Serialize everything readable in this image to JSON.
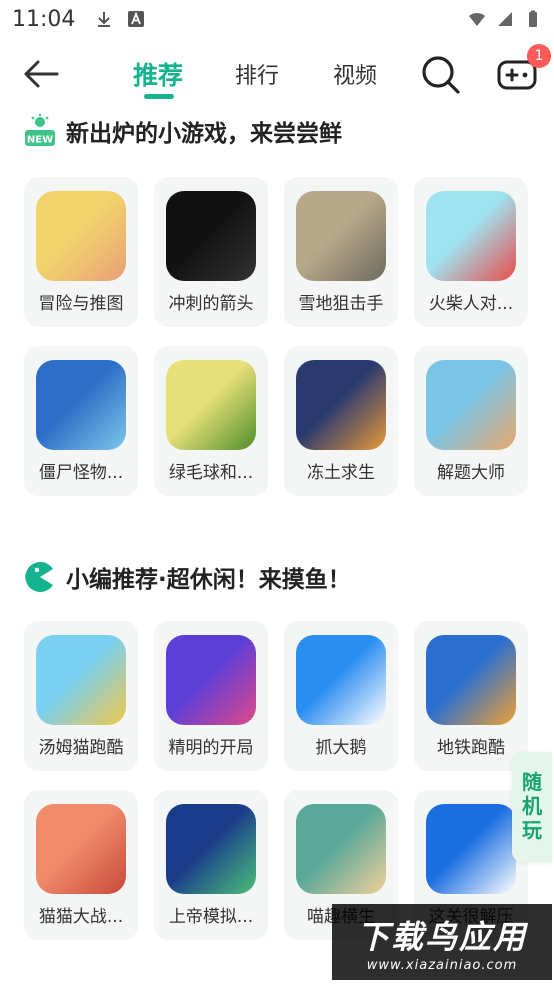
{
  "status_bar": {
    "time": "11:04"
  },
  "nav": {
    "tabs": [
      {
        "label": "推荐",
        "active": true
      },
      {
        "label": "排行",
        "active": false
      },
      {
        "label": "视频",
        "active": false
      }
    ],
    "badge_count": "1",
    "accent": "#16b38f"
  },
  "sections": [
    {
      "title": "新出炉的小游戏，来尝尝鲜",
      "badge_text": "NEW",
      "games": [
        {
          "name": "冒险与推图",
          "colors": [
            "#f2d36b",
            "#e8a07a"
          ]
        },
        {
          "name": "冲刺的箭头",
          "colors": [
            "#111111",
            "#333333"
          ]
        },
        {
          "name": "雪地狙击手",
          "colors": [
            "#b8a88a",
            "#6d6a5e"
          ]
        },
        {
          "name": "火柴人对...",
          "colors": [
            "#9fe3f0",
            "#e84b4b"
          ]
        },
        {
          "name": "僵尸怪物...",
          "colors": [
            "#2d6fc8",
            "#7cc7ea"
          ]
        },
        {
          "name": "绿毛球和...",
          "colors": [
            "#e8e07a",
            "#4f8e2a"
          ]
        },
        {
          "name": "冻土求生",
          "colors": [
            "#2a3a6e",
            "#e89a3a"
          ]
        },
        {
          "name": "解题大师",
          "colors": [
            "#7ac4e8",
            "#e8a86a"
          ]
        }
      ]
    },
    {
      "title": "小编推荐·超休闲！来摸鱼！",
      "games": [
        {
          "name": "汤姆猫跑酷",
          "colors": [
            "#7ad0f0",
            "#f0c84a"
          ]
        },
        {
          "name": "精明的开局",
          "colors": [
            "#5b3ed6",
            "#e04a8a"
          ]
        },
        {
          "name": "抓大鹅",
          "colors": [
            "#2a8ef0",
            "#ffffff"
          ]
        },
        {
          "name": "地铁跑酷",
          "colors": [
            "#2a6fd0",
            "#f0a030"
          ]
        },
        {
          "name": "猫猫大战...",
          "colors": [
            "#f08a6a",
            "#c84a3a"
          ]
        },
        {
          "name": "上帝模拟...",
          "colors": [
            "#1a3a8a",
            "#4ac07a"
          ]
        },
        {
          "name": "喵趣横生",
          "colors": [
            "#5aa89a",
            "#f0d09a"
          ]
        },
        {
          "name": "这关很解压",
          "colors": [
            "#1a6ee0",
            "#ffffff"
          ]
        }
      ]
    }
  ],
  "float_button": {
    "label": "随机玩"
  },
  "watermark": {
    "main": "下载鸟应用",
    "url": "www.xiazainiao.com"
  }
}
